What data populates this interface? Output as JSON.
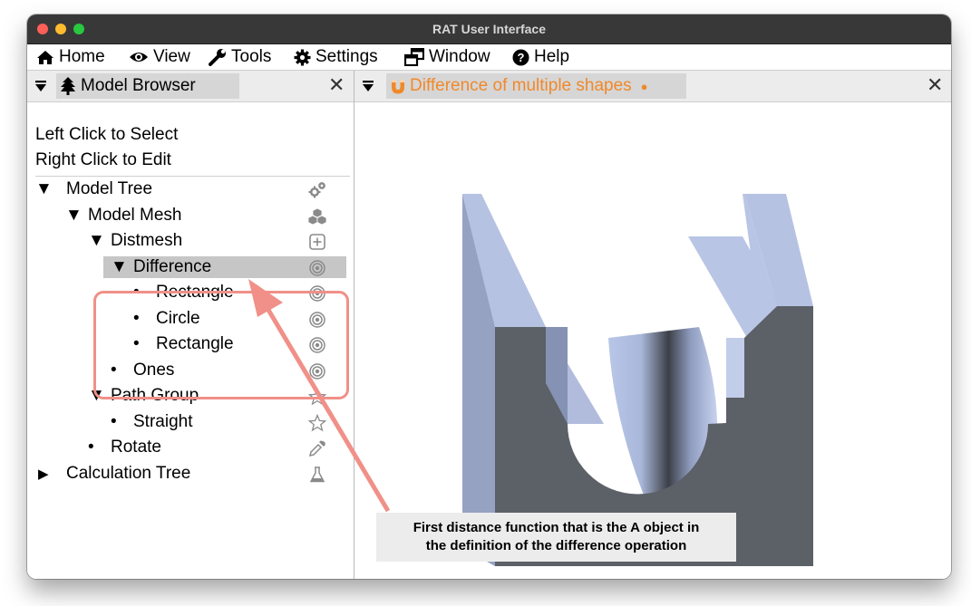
{
  "window": {
    "title": "RAT User Interface"
  },
  "menu": {
    "items": [
      {
        "label": "Home",
        "icon": "home-icon"
      },
      {
        "label": "View",
        "icon": "eye-icon"
      },
      {
        "label": "Tools",
        "icon": "wrench-icon"
      },
      {
        "label": "Settings",
        "icon": "gear-icon"
      },
      {
        "label": "Window",
        "icon": "window-icon"
      },
      {
        "label": "Help",
        "icon": "question-circle-icon"
      }
    ]
  },
  "model_browser": {
    "tab_label": "Model Browser",
    "tab_icon": "tree-icon",
    "hint_line1": "Left Click to Select",
    "hint_line2": "Right Click to Edit",
    "tree": [
      {
        "label": "Model Tree",
        "marker": "▼",
        "icon": "gears-icon",
        "depth": 0
      },
      {
        "label": "Model Mesh",
        "marker": "▼",
        "icon": "cubes-icon",
        "depth": 1
      },
      {
        "label": "Distmesh",
        "marker": "▼",
        "icon": "plus-square-icon",
        "depth": 2
      },
      {
        "label": "Difference",
        "marker": "▼",
        "icon": "target-icon",
        "depth": 3,
        "selected": true
      },
      {
        "label": "Rectangle",
        "marker": "•",
        "icon": "target-icon",
        "depth": 4
      },
      {
        "label": "Circle",
        "marker": "•",
        "icon": "target-icon",
        "depth": 4
      },
      {
        "label": "Rectangle",
        "marker": "•",
        "icon": "target-icon",
        "depth": 4
      },
      {
        "label": "Ones",
        "marker": "•",
        "icon": "target-icon",
        "depth": 3
      },
      {
        "label": "Path Group",
        "marker": "▼",
        "icon": "star-outline-icon",
        "depth": 2
      },
      {
        "label": "Straight",
        "marker": "•",
        "icon": "star-outline-icon",
        "depth": 3
      },
      {
        "label": "Rotate",
        "marker": "•",
        "icon": "eyedropper-icon",
        "depth": 2
      },
      {
        "label": "Calculation Tree",
        "marker": "▶",
        "icon": "flask-icon",
        "depth": 0
      }
    ]
  },
  "viewer": {
    "tab_label": "Difference of multiple shapes",
    "tab_icon": "magnet-icon",
    "modified_indicator": "●",
    "accent_color": "#f0892a"
  },
  "annotation": {
    "line1": "First distance function that is the A object in",
    "line2": "the definition of the difference operation"
  },
  "close_glyph": "✕"
}
